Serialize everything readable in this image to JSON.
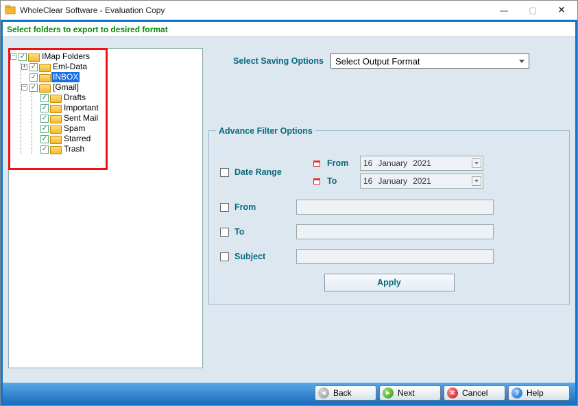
{
  "window": {
    "title": "WholeClear Software - Evaluation Copy"
  },
  "header": {
    "instruction": "Select folders to export to desired format"
  },
  "tree": {
    "root": "IMap Folders",
    "eml": "Eml-Data",
    "inbox": "INBOX",
    "gmail": "[Gmail]",
    "drafts": "Drafts",
    "important": "Important",
    "sentmail": "Sent Mail",
    "spam": "Spam",
    "starred": "Starred",
    "trash": "Trash"
  },
  "saving": {
    "label": "Select Saving Options",
    "placeholder": "Select Output Format"
  },
  "filter": {
    "legend": "Advance Filter Options",
    "date_range": "Date Range",
    "from_lbl": "From",
    "to_lbl": "To",
    "date_from_day": "16",
    "date_from_month": "January",
    "date_from_year": "2021",
    "date_to_day": "16",
    "date_to_month": "January",
    "date_to_year": "2021",
    "from": "From",
    "to": "To",
    "subject": "Subject",
    "apply": "Apply"
  },
  "footer": {
    "back": "Back",
    "next": "Next",
    "cancel": "Cancel",
    "help": "Help"
  }
}
